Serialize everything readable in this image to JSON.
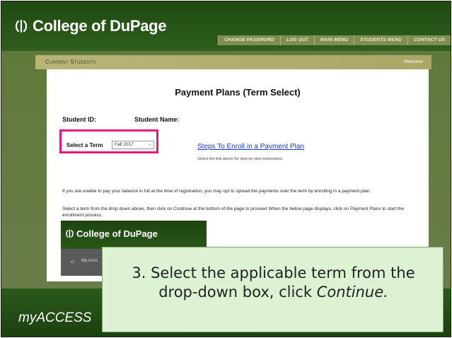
{
  "header": {
    "logo_text": "College of DuPage",
    "nav": [
      "Change Password",
      "Log Out",
      "Main Menu",
      "Students Menu",
      "Contact Us"
    ]
  },
  "subheader": {
    "section": "Current Students",
    "welcome": "Welcome"
  },
  "main": {
    "title": "Payment Plans (Term Select)",
    "student_id_label": "Student ID:",
    "student_name_label": "Student Name:",
    "term_label": "Select a Term",
    "term_value": "Fall 2017",
    "steps_link": "Steps To Enroll in a Payment Plan",
    "steps_sub": "Select the link above for step-by-step instructions.",
    "para1": "If you are unable to pay your balance in full at the time of registration, you may opt to spread the payments over the term by enrolling in a payment plan.",
    "para2": "Select a term from the drop down above, then click on Continue at the bottom of the page to proceed When the below page displays, click on Payment Plans to start the enrollment process."
  },
  "inset": {
    "logo_text": "College of DuPage",
    "account": "My Acco"
  },
  "footer": {
    "brand": "myACCESS"
  },
  "callout": {
    "line1": "3. Select the applicable term from the",
    "line2_prefix": "drop-down box, click ",
    "line2_em": "Continue."
  },
  "colors": {
    "highlight": "#e8187a",
    "link": "#1a3bbf",
    "header_green": "#1f4a12",
    "callout_bg": "#dcf2d2"
  }
}
